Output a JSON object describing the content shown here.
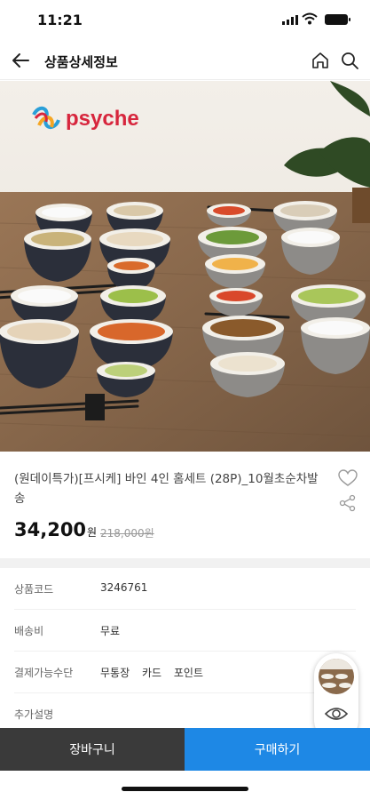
{
  "status_bar": {
    "time": "11:21"
  },
  "header": {
    "title": "상품상세정보",
    "icons": [
      "back-arrow-icon",
      "home-icon",
      "search-icon"
    ]
  },
  "hero": {
    "brand_logo_text": "psyche"
  },
  "product": {
    "name": "(원데이특가)[프시케] 바인 4인 홈세트 (28P)_10월초순차발송",
    "price": "34,200",
    "price_unit": "원",
    "original_price": "218,000원"
  },
  "specs": [
    {
      "label": "상품코드",
      "value": "3246761"
    },
    {
      "label": "배송비",
      "value": "무료"
    },
    {
      "label": "결제가능수단",
      "values": [
        "무통장",
        "카드",
        "포인트"
      ]
    },
    {
      "label": "추가설명",
      "value": ""
    }
  ],
  "bottom_bar": {
    "cart_label": "장바구니",
    "buy_label": "구매하기"
  },
  "colors": {
    "buy": "#1e88e5",
    "cart": "#3a3a3a",
    "brand_red": "#d7263d"
  }
}
